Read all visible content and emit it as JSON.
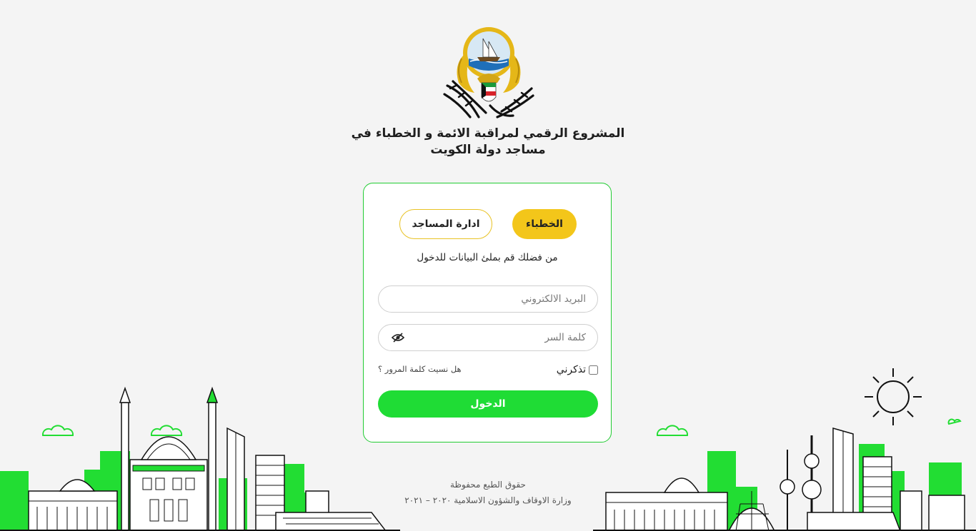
{
  "header": {
    "title_line1": "المشروع الرقمي لمراقبة الائمة و الخطباء في",
    "title_line2": "مساجد دولة الكويت"
  },
  "tabs": {
    "khutaba": "الخطباء",
    "masajid": "ادارة المساجد"
  },
  "login": {
    "instruction": "من فضلك قم بملئ البيانات للدخول",
    "email_placeholder": "البريد الالكتروني",
    "password_placeholder": "كلمة السر",
    "remember_label": "تذكرني",
    "forgot_link": "هل نسيت كلمة المرور ؟",
    "submit_label": "الدخول"
  },
  "footer": {
    "rights": "حقوق الطبع محفوظة",
    "ministry": "وزارة الاوقاف والشؤون الاسلامية ٢٠٢٠ – ٢٠٢١"
  },
  "colors": {
    "primary_green": "#1fdc35",
    "accent_yellow": "#f3c61a",
    "card_border": "#22cc33"
  }
}
